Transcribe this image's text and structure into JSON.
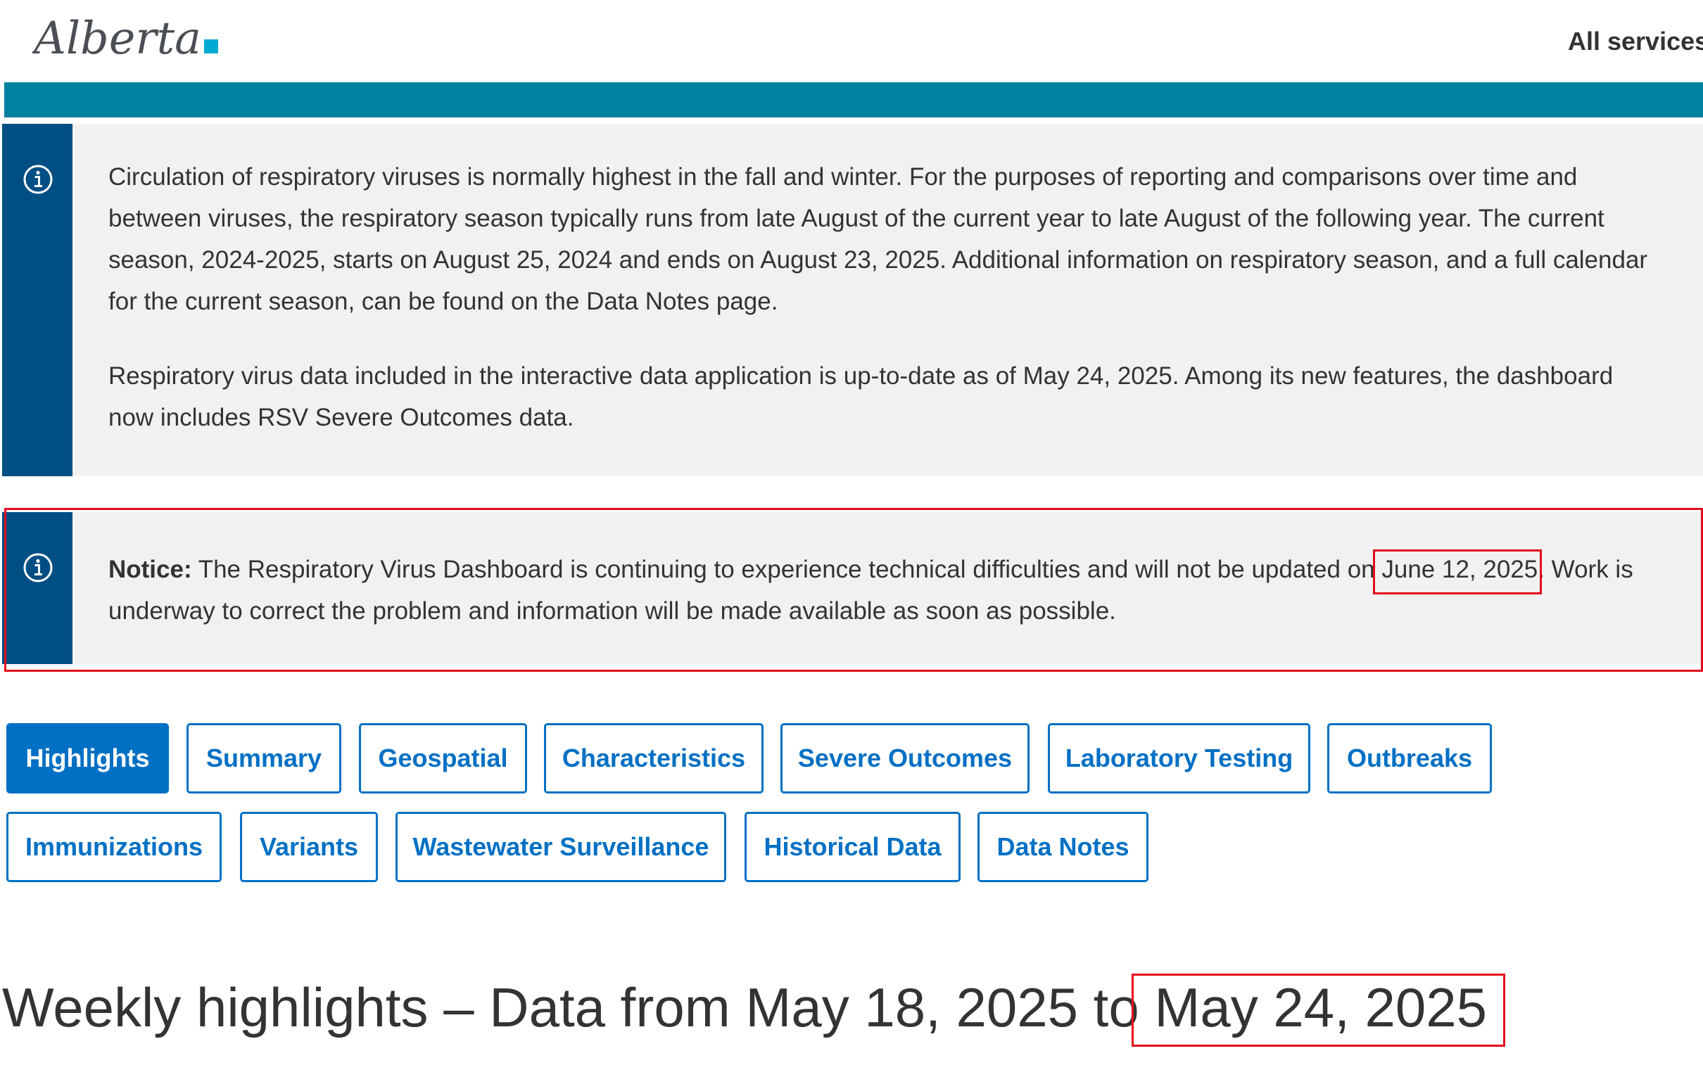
{
  "header": {
    "logo_text": "Alberta",
    "all_services": "All services"
  },
  "info_callout": {
    "paragraph_1": "Circulation of respiratory viruses is normally highest in the fall and winter. For the purposes of reporting and comparisons over time and between viruses, the respiratory season typically runs from late August of the current year to late August of the following year. The current season, 2024-2025, starts on August 25, 2024 and ends on August 23, 2025. Additional information on respiratory season, and a full calendar for the current season, can be found on the Data Notes page.",
    "paragraph_2": "Respiratory virus data included in the interactive data application is up-to-date as of May 24, 2025. Among its new features, the dashboard now includes RSV Severe Outcomes data."
  },
  "notice_callout": {
    "label": "Notice:",
    "text_before": " The Respiratory Virus Dashboard is continuing to experience technical difficulties and will not be updated on ",
    "date": "June 12, 2025",
    "text_after": ". Work is underway to correct the problem and information will be made available as soon as possible."
  },
  "tabs": [
    {
      "label": "Highlights",
      "active": true
    },
    {
      "label": "Summary"
    },
    {
      "label": "Geospatial"
    },
    {
      "label": "Characteristics"
    },
    {
      "label": "Severe Outcomes"
    },
    {
      "label": "Laboratory Testing"
    },
    {
      "label": "Outbreaks"
    },
    {
      "label": "Immunizations"
    },
    {
      "label": "Variants"
    },
    {
      "label": "Wastewater Surveillance"
    },
    {
      "label": "Historical Data"
    },
    {
      "label": "Data Notes"
    }
  ],
  "heading": {
    "prefix": "Weekly highlights – Data from May 18, 2025 to",
    "end_date": "May 24, 2025"
  },
  "colors": {
    "teal_bar": "#0081a2",
    "callout_stripe": "#004f84",
    "tab_blue": "#0070c4",
    "highlight_red": "#e30e1d"
  }
}
